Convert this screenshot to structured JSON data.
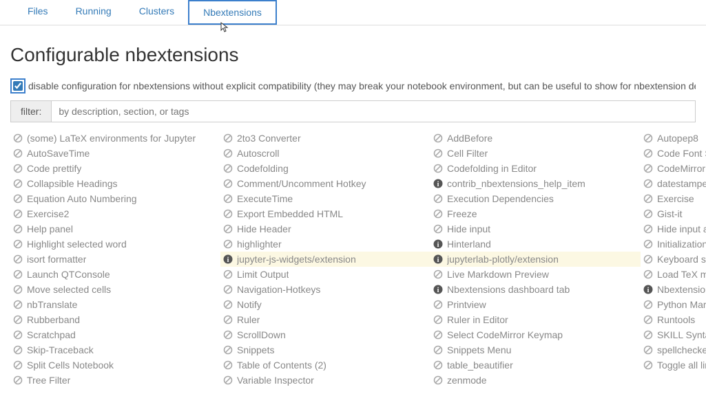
{
  "tabs": [
    {
      "label": "Files"
    },
    {
      "label": "Running"
    },
    {
      "label": "Clusters"
    },
    {
      "label": "Nbextensions"
    }
  ],
  "page": {
    "title": "Configurable nbextensions",
    "disable_compat_label": "disable configuration for nbextensions without explicit compatibility (they may break your notebook environment, but can be useful to show for nbextension development)"
  },
  "filter": {
    "label": "filter:",
    "placeholder": "by description, section, or tags"
  },
  "extensions": [
    {
      "name": "(some) LaTeX environments for Jupyter",
      "icon": "disabled"
    },
    {
      "name": "2to3 Converter",
      "icon": "disabled"
    },
    {
      "name": "AddBefore",
      "icon": "disabled"
    },
    {
      "name": "Autopep8",
      "icon": "disabled"
    },
    {
      "name": "AutoSaveTime",
      "icon": "disabled"
    },
    {
      "name": "Autoscroll",
      "icon": "disabled"
    },
    {
      "name": "Cell Filter",
      "icon": "disabled"
    },
    {
      "name": "Code Font Size",
      "icon": "disabled"
    },
    {
      "name": "Code prettify",
      "icon": "disabled"
    },
    {
      "name": "Codefolding",
      "icon": "disabled"
    },
    {
      "name": "Codefolding in Editor",
      "icon": "disabled"
    },
    {
      "name": "CodeMirror mode extensions",
      "icon": "disabled"
    },
    {
      "name": "Collapsible Headings",
      "icon": "disabled"
    },
    {
      "name": "Comment/Uncomment Hotkey",
      "icon": "disabled"
    },
    {
      "name": "contrib_nbextensions_help_item",
      "icon": "info"
    },
    {
      "name": "datestamper",
      "icon": "disabled"
    },
    {
      "name": "Equation Auto Numbering",
      "icon": "disabled"
    },
    {
      "name": "ExecuteTime",
      "icon": "disabled"
    },
    {
      "name": "Execution Dependencies",
      "icon": "disabled"
    },
    {
      "name": "Exercise",
      "icon": "disabled"
    },
    {
      "name": "Exercise2",
      "icon": "disabled"
    },
    {
      "name": "Export Embedded HTML",
      "icon": "disabled"
    },
    {
      "name": "Freeze",
      "icon": "disabled"
    },
    {
      "name": "Gist-it",
      "icon": "disabled"
    },
    {
      "name": "Help panel",
      "icon": "disabled"
    },
    {
      "name": "Hide Header",
      "icon": "disabled"
    },
    {
      "name": "Hide input",
      "icon": "disabled"
    },
    {
      "name": "Hide input all",
      "icon": "disabled"
    },
    {
      "name": "Highlight selected word",
      "icon": "disabled"
    },
    {
      "name": "highlighter",
      "icon": "disabled"
    },
    {
      "name": "Hinterland",
      "icon": "info"
    },
    {
      "name": "Initialization cells",
      "icon": "disabled"
    },
    {
      "name": "isort formatter",
      "icon": "disabled"
    },
    {
      "name": "jupyter-js-widgets/extension",
      "icon": "info",
      "warn": true
    },
    {
      "name": "jupyterlab-plotly/extension",
      "icon": "info",
      "warn": true
    },
    {
      "name": "Keyboard shortcut editor",
      "icon": "disabled"
    },
    {
      "name": "Launch QTConsole",
      "icon": "disabled"
    },
    {
      "name": "Limit Output",
      "icon": "disabled"
    },
    {
      "name": "Live Markdown Preview",
      "icon": "disabled"
    },
    {
      "name": "Load TeX macros",
      "icon": "disabled"
    },
    {
      "name": "Move selected cells",
      "icon": "disabled"
    },
    {
      "name": "Navigation-Hotkeys",
      "icon": "disabled"
    },
    {
      "name": "Nbextensions dashboard tab",
      "icon": "info"
    },
    {
      "name": "Nbextensions edit menu item",
      "icon": "info"
    },
    {
      "name": "nbTranslate",
      "icon": "disabled"
    },
    {
      "name": "Notify",
      "icon": "disabled"
    },
    {
      "name": "Printview",
      "icon": "disabled"
    },
    {
      "name": "Python Markdown",
      "icon": "disabled"
    },
    {
      "name": "Rubberband",
      "icon": "disabled"
    },
    {
      "name": "Ruler",
      "icon": "disabled"
    },
    {
      "name": "Ruler in Editor",
      "icon": "disabled"
    },
    {
      "name": "Runtools",
      "icon": "disabled"
    },
    {
      "name": "Scratchpad",
      "icon": "disabled"
    },
    {
      "name": "ScrollDown",
      "icon": "disabled"
    },
    {
      "name": "Select CodeMirror Keymap",
      "icon": "disabled"
    },
    {
      "name": "SKILL Syntax",
      "icon": "disabled"
    },
    {
      "name": "Skip-Traceback",
      "icon": "disabled"
    },
    {
      "name": "Snippets",
      "icon": "disabled"
    },
    {
      "name": "Snippets Menu",
      "icon": "disabled"
    },
    {
      "name": "spellchecker",
      "icon": "disabled"
    },
    {
      "name": "Split Cells Notebook",
      "icon": "disabled"
    },
    {
      "name": "Table of Contents (2)",
      "icon": "disabled"
    },
    {
      "name": "table_beautifier",
      "icon": "disabled"
    },
    {
      "name": "Toggle all line numbers",
      "icon": "disabled"
    },
    {
      "name": "Tree Filter",
      "icon": "disabled"
    },
    {
      "name": "Variable Inspector",
      "icon": "disabled"
    },
    {
      "name": "zenmode",
      "icon": "disabled"
    }
  ]
}
